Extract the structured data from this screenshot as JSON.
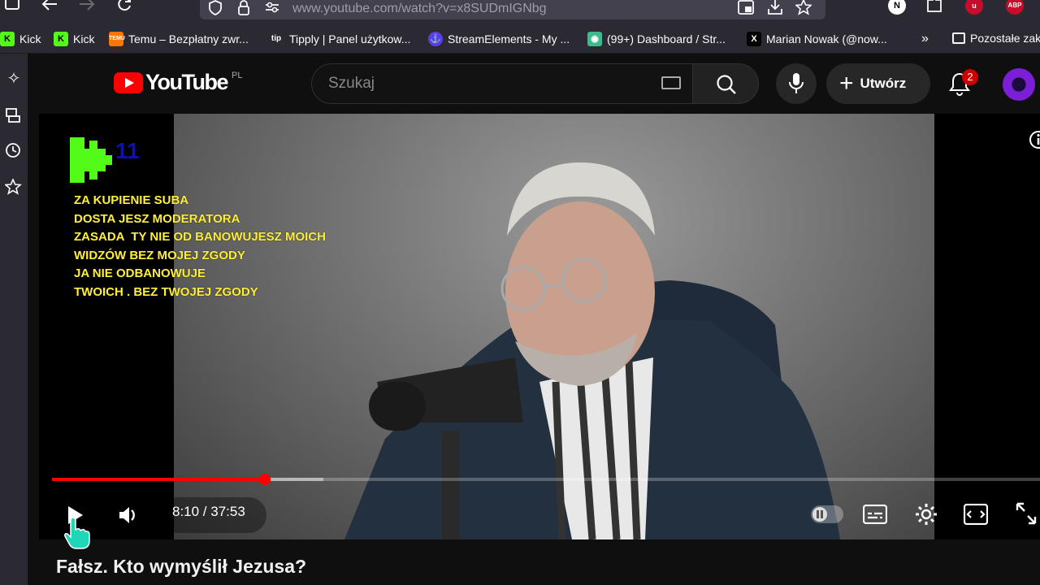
{
  "browser": {
    "url": "www.youtube.com/watch?v=x8SUDmIGNbg",
    "nav": [
      "back-icon",
      "forward-icon",
      "reload-icon"
    ],
    "extensions": [
      {
        "name": "n-extension-icon",
        "label": "N",
        "color": "#ffffff"
      },
      {
        "name": "abp-extension-icon",
        "label": "ABP",
        "color": "#c70d2c"
      }
    ]
  },
  "bookmarks": [
    {
      "label": "Kick",
      "icon": "kick-icon",
      "color": "#53fc18"
    },
    {
      "label": "Kick",
      "icon": "kick-icon",
      "color": "#53fc18"
    },
    {
      "label": "Temu – Bezpłatny zwr...",
      "icon": "temu-icon",
      "color": "#fb7701"
    },
    {
      "label": "Tipply | Panel użytkow...",
      "icon": "tipply-icon",
      "color": "#2b2a33"
    },
    {
      "label": "StreamElements - My ...",
      "icon": "streamelements-icon",
      "color": "#5a3ee8"
    },
    {
      "label": "(99+) Dashboard / Str...",
      "icon": "discord-like-icon",
      "color": "#3dba8e"
    },
    {
      "label": "Marian Nowak (@now...",
      "icon": "x-icon",
      "color": "#000000"
    },
    {
      "label": "Pozostałe zak",
      "icon": "folder-icon",
      "color": "#fbfbfe"
    }
  ],
  "bookmarks_overflow_icon": "chevrons-right-icon",
  "sidebar_icons": [
    "sparkle-icon",
    "sync-tabs-icon",
    "history-icon",
    "star-icon"
  ],
  "youtube": {
    "logo_word": "YouTube",
    "country_code": "PL",
    "search_placeholder": "Szukaj",
    "create_label": "Utwórz",
    "notification_count": "2"
  },
  "overlay": {
    "kick_number": "11",
    "lines": "ZA KUPIENIE SUBA\nDOSTA JESZ MODERATORA\nZASADA  TY NIE OD BANOWUJESZ MOICH\nWIDZÓW BEZ MOJEJ ZGODY\nJA NIE ODBANOWUJE\nTWOICH . BEZ TWOJEJ ZGODY"
  },
  "player": {
    "current_time": "8:10",
    "duration": "37:53",
    "time_display": "8:10 / 37:53",
    "progress_fraction": 0.2155,
    "buffered_fraction": 0.2745,
    "state": "paused"
  },
  "video": {
    "title": "Fałsz. Kto wymyślił Jezusa?"
  }
}
